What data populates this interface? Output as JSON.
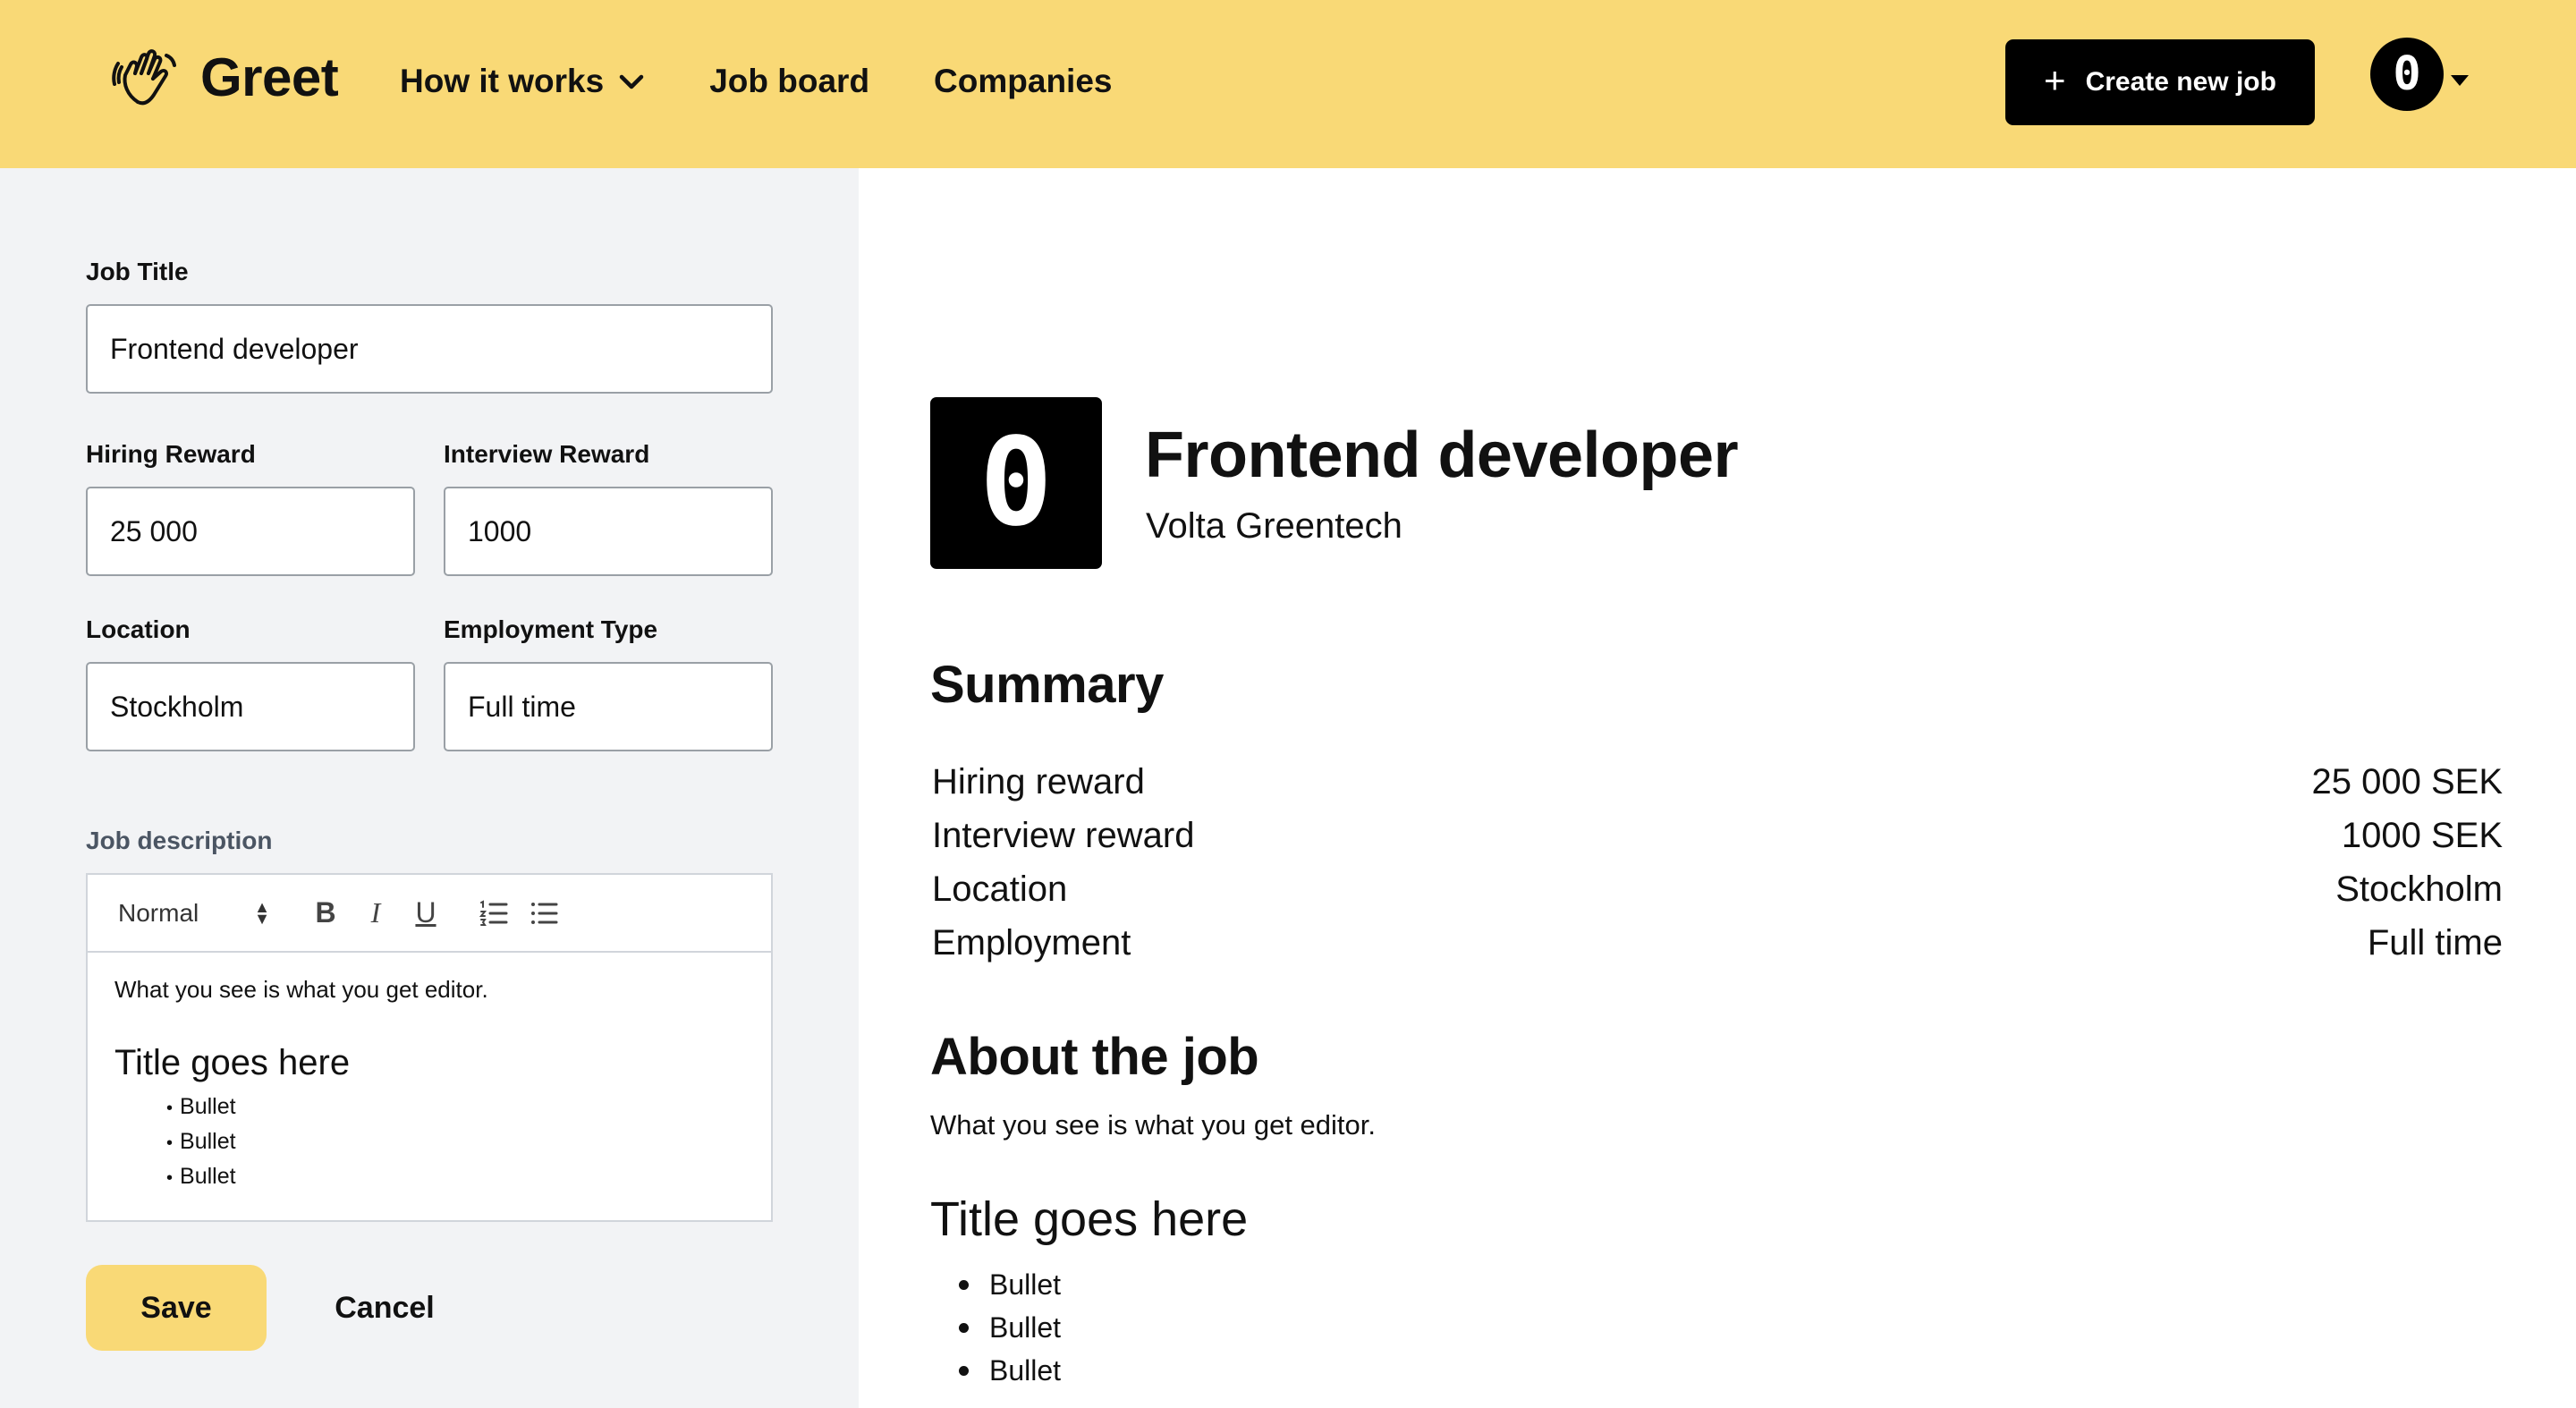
{
  "header": {
    "brand": "Greet",
    "nav": [
      "How it works",
      "Job board",
      "Companies"
    ],
    "create_button": "Create new job",
    "avatar_text": "0"
  },
  "form": {
    "job_title_label": "Job Title",
    "job_title_value": "Frontend developer",
    "hiring_reward_label": "Hiring Reward",
    "hiring_reward_value": "25 000",
    "interview_reward_label": "Interview Reward",
    "interview_reward_value": "1000",
    "location_label": "Location",
    "location_value": "Stockholm",
    "employment_type_label": "Employment Type",
    "employment_type_value": "Full time",
    "description_label": "Job description",
    "editor": {
      "style_select": "Normal",
      "paragraph": "What you see is what you get editor.",
      "heading": "Title goes here",
      "bullets": [
        "Bullet",
        "Bullet",
        "Bullet"
      ]
    },
    "save_label": "Save",
    "cancel_label": "Cancel"
  },
  "preview": {
    "logo_text": "0",
    "title": "Frontend developer",
    "company": "Volta Greentech",
    "summary_heading": "Summary",
    "summary": [
      {
        "label": "Hiring reward",
        "value": "25 000 SEK"
      },
      {
        "label": "Interview reward",
        "value": "1000 SEK"
      },
      {
        "label": "Location",
        "value": "Stockholm"
      },
      {
        "label": "Employment",
        "value": "Full time"
      }
    ],
    "about_heading": "About the job",
    "about_paragraph": "What you see is what you get editor.",
    "about_title": "Title goes here",
    "about_bullets": [
      "Bullet",
      "Bullet",
      "Bullet"
    ]
  },
  "colors": {
    "brand_yellow": "#F9D976",
    "panel_bg": "#F2F3F5",
    "primary_dark": "#000000"
  }
}
